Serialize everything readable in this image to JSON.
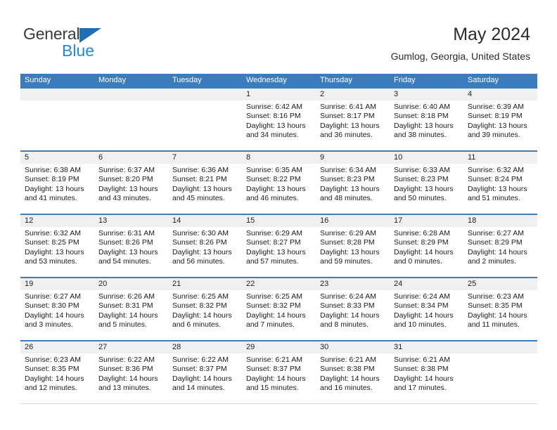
{
  "brand": {
    "name_line1": "General",
    "name_line2": "Blue",
    "primary_color": "#1f6db5",
    "accent_color": "#1f8ad6"
  },
  "header": {
    "month_title": "May 2024",
    "location": "Gumlog, Georgia, United States"
  },
  "calendar": {
    "header_bg": "#3b7cbf",
    "day_band_bg": "#f0f0f0",
    "weekdays": [
      "Sunday",
      "Monday",
      "Tuesday",
      "Wednesday",
      "Thursday",
      "Friday",
      "Saturday"
    ],
    "weeks": [
      [
        {
          "day": "",
          "empty": true
        },
        {
          "day": "",
          "empty": true
        },
        {
          "day": "",
          "empty": true
        },
        {
          "day": "1",
          "sunrise": "Sunrise: 6:42 AM",
          "sunset": "Sunset: 8:16 PM",
          "daylight": "Daylight: 13 hours and 34 minutes."
        },
        {
          "day": "2",
          "sunrise": "Sunrise: 6:41 AM",
          "sunset": "Sunset: 8:17 PM",
          "daylight": "Daylight: 13 hours and 36 minutes."
        },
        {
          "day": "3",
          "sunrise": "Sunrise: 6:40 AM",
          "sunset": "Sunset: 8:18 PM",
          "daylight": "Daylight: 13 hours and 38 minutes."
        },
        {
          "day": "4",
          "sunrise": "Sunrise: 6:39 AM",
          "sunset": "Sunset: 8:19 PM",
          "daylight": "Daylight: 13 hours and 39 minutes."
        }
      ],
      [
        {
          "day": "5",
          "sunrise": "Sunrise: 6:38 AM",
          "sunset": "Sunset: 8:19 PM",
          "daylight": "Daylight: 13 hours and 41 minutes."
        },
        {
          "day": "6",
          "sunrise": "Sunrise: 6:37 AM",
          "sunset": "Sunset: 8:20 PM",
          "daylight": "Daylight: 13 hours and 43 minutes."
        },
        {
          "day": "7",
          "sunrise": "Sunrise: 6:36 AM",
          "sunset": "Sunset: 8:21 PM",
          "daylight": "Daylight: 13 hours and 45 minutes."
        },
        {
          "day": "8",
          "sunrise": "Sunrise: 6:35 AM",
          "sunset": "Sunset: 8:22 PM",
          "daylight": "Daylight: 13 hours and 46 minutes."
        },
        {
          "day": "9",
          "sunrise": "Sunrise: 6:34 AM",
          "sunset": "Sunset: 8:23 PM",
          "daylight": "Daylight: 13 hours and 48 minutes."
        },
        {
          "day": "10",
          "sunrise": "Sunrise: 6:33 AM",
          "sunset": "Sunset: 8:23 PM",
          "daylight": "Daylight: 13 hours and 50 minutes."
        },
        {
          "day": "11",
          "sunrise": "Sunrise: 6:32 AM",
          "sunset": "Sunset: 8:24 PM",
          "daylight": "Daylight: 13 hours and 51 minutes."
        }
      ],
      [
        {
          "day": "12",
          "sunrise": "Sunrise: 6:32 AM",
          "sunset": "Sunset: 8:25 PM",
          "daylight": "Daylight: 13 hours and 53 minutes."
        },
        {
          "day": "13",
          "sunrise": "Sunrise: 6:31 AM",
          "sunset": "Sunset: 8:26 PM",
          "daylight": "Daylight: 13 hours and 54 minutes."
        },
        {
          "day": "14",
          "sunrise": "Sunrise: 6:30 AM",
          "sunset": "Sunset: 8:26 PM",
          "daylight": "Daylight: 13 hours and 56 minutes."
        },
        {
          "day": "15",
          "sunrise": "Sunrise: 6:29 AM",
          "sunset": "Sunset: 8:27 PM",
          "daylight": "Daylight: 13 hours and 57 minutes."
        },
        {
          "day": "16",
          "sunrise": "Sunrise: 6:29 AM",
          "sunset": "Sunset: 8:28 PM",
          "daylight": "Daylight: 13 hours and 59 minutes."
        },
        {
          "day": "17",
          "sunrise": "Sunrise: 6:28 AM",
          "sunset": "Sunset: 8:29 PM",
          "daylight": "Daylight: 14 hours and 0 minutes."
        },
        {
          "day": "18",
          "sunrise": "Sunrise: 6:27 AM",
          "sunset": "Sunset: 8:29 PM",
          "daylight": "Daylight: 14 hours and 2 minutes."
        }
      ],
      [
        {
          "day": "19",
          "sunrise": "Sunrise: 6:27 AM",
          "sunset": "Sunset: 8:30 PM",
          "daylight": "Daylight: 14 hours and 3 minutes."
        },
        {
          "day": "20",
          "sunrise": "Sunrise: 6:26 AM",
          "sunset": "Sunset: 8:31 PM",
          "daylight": "Daylight: 14 hours and 5 minutes."
        },
        {
          "day": "21",
          "sunrise": "Sunrise: 6:25 AM",
          "sunset": "Sunset: 8:32 PM",
          "daylight": "Daylight: 14 hours and 6 minutes."
        },
        {
          "day": "22",
          "sunrise": "Sunrise: 6:25 AM",
          "sunset": "Sunset: 8:32 PM",
          "daylight": "Daylight: 14 hours and 7 minutes."
        },
        {
          "day": "23",
          "sunrise": "Sunrise: 6:24 AM",
          "sunset": "Sunset: 8:33 PM",
          "daylight": "Daylight: 14 hours and 8 minutes."
        },
        {
          "day": "24",
          "sunrise": "Sunrise: 6:24 AM",
          "sunset": "Sunset: 8:34 PM",
          "daylight": "Daylight: 14 hours and 10 minutes."
        },
        {
          "day": "25",
          "sunrise": "Sunrise: 6:23 AM",
          "sunset": "Sunset: 8:35 PM",
          "daylight": "Daylight: 14 hours and 11 minutes."
        }
      ],
      [
        {
          "day": "26",
          "sunrise": "Sunrise: 6:23 AM",
          "sunset": "Sunset: 8:35 PM",
          "daylight": "Daylight: 14 hours and 12 minutes."
        },
        {
          "day": "27",
          "sunrise": "Sunrise: 6:22 AM",
          "sunset": "Sunset: 8:36 PM",
          "daylight": "Daylight: 14 hours and 13 minutes."
        },
        {
          "day": "28",
          "sunrise": "Sunrise: 6:22 AM",
          "sunset": "Sunset: 8:37 PM",
          "daylight": "Daylight: 14 hours and 14 minutes."
        },
        {
          "day": "29",
          "sunrise": "Sunrise: 6:21 AM",
          "sunset": "Sunset: 8:37 PM",
          "daylight": "Daylight: 14 hours and 15 minutes."
        },
        {
          "day": "30",
          "sunrise": "Sunrise: 6:21 AM",
          "sunset": "Sunset: 8:38 PM",
          "daylight": "Daylight: 14 hours and 16 minutes."
        },
        {
          "day": "31",
          "sunrise": "Sunrise: 6:21 AM",
          "sunset": "Sunset: 8:38 PM",
          "daylight": "Daylight: 14 hours and 17 minutes."
        },
        {
          "day": "",
          "empty": true
        }
      ]
    ]
  }
}
